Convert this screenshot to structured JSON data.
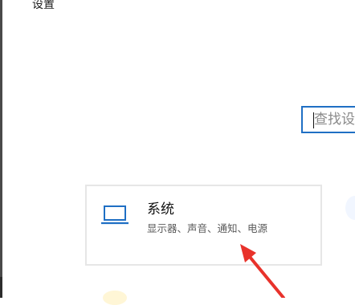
{
  "window": {
    "title": "设置"
  },
  "search": {
    "placeholder": "查找设"
  },
  "categories": [
    {
      "icon": "laptop-icon",
      "title": "系统",
      "description": "显示器、声音、通知、电源"
    }
  ],
  "colors": {
    "accent": "#1f6fc4",
    "annotation_arrow": "#e8322b",
    "card_border": "#e6e6e6"
  }
}
